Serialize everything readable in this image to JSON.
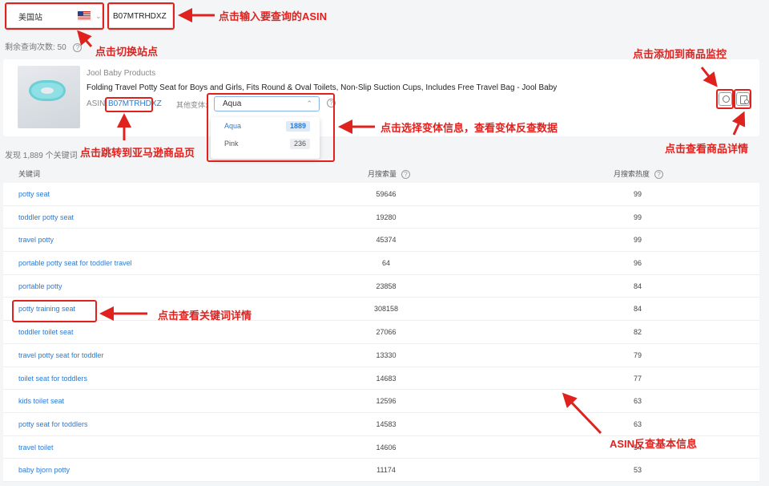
{
  "topbar": {
    "site_label": "美国站",
    "asin_value": "B07MTRHDXZ"
  },
  "remaining": {
    "label": "剩余查询次数: 50"
  },
  "product": {
    "brand": "Jool Baby Products",
    "title": "Folding Travel Potty Seat for Boys and Girls, Fits Round & Oval Toilets, Non-Slip Suction Cups, Includes Free Travel Bag - Jool Baby",
    "asin_label": "ASIN:",
    "asin_value": "B07MTRHDXZ",
    "variant_label": "其他变体:",
    "variant_selected": "Aqua",
    "variants": [
      {
        "name": "Aqua",
        "count": "1889"
      },
      {
        "name": "Pink",
        "count": "236"
      }
    ]
  },
  "found": {
    "label": "发现 1,889 个关键词"
  },
  "table": {
    "headers": {
      "keyword": "关键词",
      "volume": "月搜索量",
      "heat": "月搜索热度"
    },
    "rows": [
      {
        "keyword": "potty seat",
        "volume": "59646",
        "heat": "99"
      },
      {
        "keyword": "toddler potty seat",
        "volume": "19280",
        "heat": "99"
      },
      {
        "keyword": "travel potty",
        "volume": "45374",
        "heat": "99"
      },
      {
        "keyword": "portable potty seat for toddler travel",
        "volume": "64",
        "heat": "96"
      },
      {
        "keyword": "portable potty",
        "volume": "23858",
        "heat": "84"
      },
      {
        "keyword": "potty training seat",
        "volume": "308158",
        "heat": "84"
      },
      {
        "keyword": "toddler toilet seat",
        "volume": "27066",
        "heat": "82"
      },
      {
        "keyword": "travel potty seat for toddler",
        "volume": "13330",
        "heat": "79"
      },
      {
        "keyword": "toilet seat for toddlers",
        "volume": "14683",
        "heat": "77"
      },
      {
        "keyword": "kids toilet seat",
        "volume": "12596",
        "heat": "63"
      },
      {
        "keyword": "potty seat for toddlers",
        "volume": "14583",
        "heat": "63"
      },
      {
        "keyword": "travel toilet",
        "volume": "14606",
        "heat": "54"
      },
      {
        "keyword": "baby bjorn potty",
        "volume": "11174",
        "heat": "53"
      }
    ]
  },
  "annotations": {
    "input_asin": "点击输入要查询的ASIN",
    "switch_site": "点击切换站点",
    "add_monitor": "点击添加到商品监控",
    "select_variant": "点击选择变体信息，查看变体反查数据",
    "goto_amazon": "点击跳转到亚马逊商品页",
    "view_detail": "点击查看商品详情",
    "keyword_detail": "点击查看关键词详情",
    "basic_info": "ASIN反查基本信息"
  },
  "colors": {
    "annotation_red": "#e0221f",
    "link_blue": "#2b7bd6"
  }
}
